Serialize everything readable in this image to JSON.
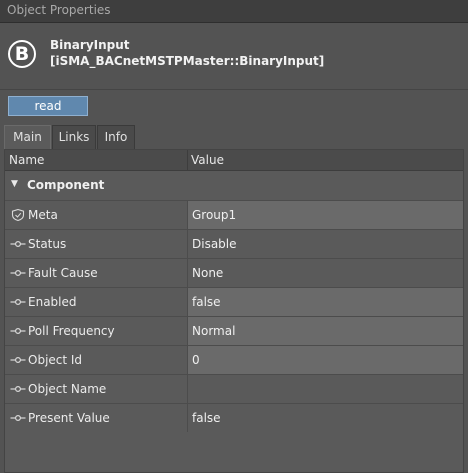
{
  "window": {
    "title": "Object Properties"
  },
  "header": {
    "badge_letter": "B",
    "name": "BinaryInput",
    "type": "[iSMA_BACnetMSTPMaster::BinaryInput]"
  },
  "actions": {
    "read_label": "read"
  },
  "tabs": [
    {
      "label": "Main",
      "active": true
    },
    {
      "label": "Links",
      "active": false
    },
    {
      "label": "Info",
      "active": false
    }
  ],
  "table": {
    "col_name": "Name",
    "col_value": "Value",
    "group_label": "Component",
    "rows": [
      {
        "name": "Meta",
        "value": "Group1",
        "icon": "shield-icon",
        "editable": true
      },
      {
        "name": "Status",
        "value": "Disable",
        "icon": "property-slot-icon",
        "editable": false
      },
      {
        "name": "Fault Cause",
        "value": "None",
        "icon": "property-slot-icon",
        "editable": false
      },
      {
        "name": "Enabled",
        "value": "false",
        "icon": "property-slot-icon",
        "editable": true
      },
      {
        "name": "Poll Frequency",
        "value": "Normal",
        "icon": "property-slot-icon",
        "editable": true
      },
      {
        "name": "Object Id",
        "value": "0",
        "icon": "property-slot-icon",
        "editable": true
      },
      {
        "name": "Object Name",
        "value": "",
        "icon": "property-slot-icon",
        "editable": false
      },
      {
        "name": "Present Value",
        "value": "false",
        "icon": "property-slot-icon",
        "editable": false
      }
    ]
  },
  "colors": {
    "button_accent": "#6088ae",
    "editable_cell": "#6a6a6a",
    "background": "#535353"
  }
}
